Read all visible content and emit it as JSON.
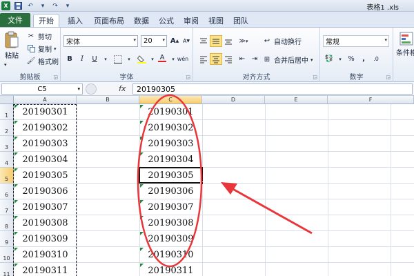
{
  "window": {
    "title": "表格1 .xls",
    "app_icon": "X"
  },
  "tabs": [
    {
      "label": "文件"
    },
    {
      "label": "开始"
    },
    {
      "label": "插入"
    },
    {
      "label": "页面布局"
    },
    {
      "label": "数据"
    },
    {
      "label": "公式"
    },
    {
      "label": "审阅"
    },
    {
      "label": "视图"
    },
    {
      "label": "团队"
    }
  ],
  "ribbon": {
    "clipboard": {
      "label": "剪贴板",
      "paste": "粘贴",
      "cut": "剪切",
      "copy": "复制",
      "format_painter": "格式刷"
    },
    "font": {
      "label": "字体",
      "font_name": "宋体",
      "font_size": "20",
      "bold": "B",
      "italic": "I",
      "underline": "U",
      "grow": "A",
      "shrink": "A",
      "phonetic": "wén",
      "font_color": "A"
    },
    "alignment": {
      "label": "对齐方式",
      "wrap_text": "自动换行",
      "merge_center": "合并后居中"
    },
    "number": {
      "label": "数字",
      "format": "常规",
      "percent": "%",
      "comma": ","
    },
    "styles": {
      "conditional": "条件格"
    }
  },
  "formula_bar": {
    "name_box": "C5",
    "fx": "fx",
    "value": "20190305"
  },
  "sheet": {
    "columns": [
      "A",
      "B",
      "C",
      "D",
      "E",
      "F"
    ],
    "rows": [
      "1",
      "2",
      "3",
      "4",
      "5",
      "6",
      "7",
      "8",
      "9",
      "10",
      "11"
    ],
    "col_a": [
      "20190301",
      "20190302",
      "20190303",
      "20190304",
      "20190305",
      "20190306",
      "20190307",
      "20190308",
      "20190309",
      "20190310",
      "20190311"
    ],
    "col_c": [
      "20190301",
      "20190302",
      "20190303",
      "20190304",
      "20190305",
      "20190306",
      "20190307",
      "20190308",
      "20190309",
      "20190310",
      "20190311"
    ],
    "active_cell": "C5"
  },
  "colors": {
    "accent": "#2a6f3d",
    "annotation": "#e8363a",
    "selection_header": "#f7cc6f"
  }
}
